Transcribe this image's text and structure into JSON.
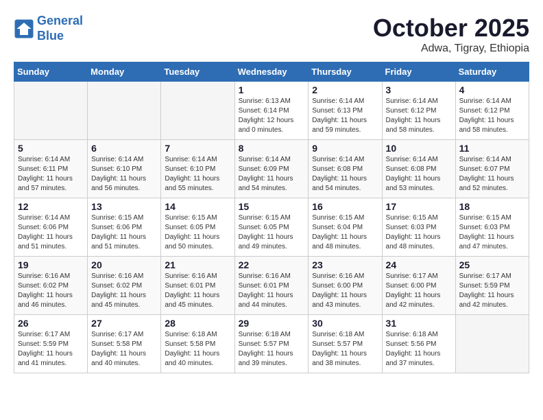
{
  "header": {
    "logo_line1": "General",
    "logo_line2": "Blue",
    "month": "October 2025",
    "location": "Adwa, Tigray, Ethiopia"
  },
  "days_of_week": [
    "Sunday",
    "Monday",
    "Tuesday",
    "Wednesday",
    "Thursday",
    "Friday",
    "Saturday"
  ],
  "weeks": [
    [
      {
        "num": "",
        "info": "",
        "empty": true
      },
      {
        "num": "",
        "info": "",
        "empty": true
      },
      {
        "num": "",
        "info": "",
        "empty": true
      },
      {
        "num": "1",
        "info": "Sunrise: 6:13 AM\nSunset: 6:14 PM\nDaylight: 12 hours\nand 0 minutes."
      },
      {
        "num": "2",
        "info": "Sunrise: 6:14 AM\nSunset: 6:13 PM\nDaylight: 11 hours\nand 59 minutes."
      },
      {
        "num": "3",
        "info": "Sunrise: 6:14 AM\nSunset: 6:12 PM\nDaylight: 11 hours\nand 58 minutes."
      },
      {
        "num": "4",
        "info": "Sunrise: 6:14 AM\nSunset: 6:12 PM\nDaylight: 11 hours\nand 58 minutes."
      }
    ],
    [
      {
        "num": "5",
        "info": "Sunrise: 6:14 AM\nSunset: 6:11 PM\nDaylight: 11 hours\nand 57 minutes."
      },
      {
        "num": "6",
        "info": "Sunrise: 6:14 AM\nSunset: 6:10 PM\nDaylight: 11 hours\nand 56 minutes."
      },
      {
        "num": "7",
        "info": "Sunrise: 6:14 AM\nSunset: 6:10 PM\nDaylight: 11 hours\nand 55 minutes."
      },
      {
        "num": "8",
        "info": "Sunrise: 6:14 AM\nSunset: 6:09 PM\nDaylight: 11 hours\nand 54 minutes."
      },
      {
        "num": "9",
        "info": "Sunrise: 6:14 AM\nSunset: 6:08 PM\nDaylight: 11 hours\nand 54 minutes."
      },
      {
        "num": "10",
        "info": "Sunrise: 6:14 AM\nSunset: 6:08 PM\nDaylight: 11 hours\nand 53 minutes."
      },
      {
        "num": "11",
        "info": "Sunrise: 6:14 AM\nSunset: 6:07 PM\nDaylight: 11 hours\nand 52 minutes."
      }
    ],
    [
      {
        "num": "12",
        "info": "Sunrise: 6:14 AM\nSunset: 6:06 PM\nDaylight: 11 hours\nand 51 minutes."
      },
      {
        "num": "13",
        "info": "Sunrise: 6:15 AM\nSunset: 6:06 PM\nDaylight: 11 hours\nand 51 minutes."
      },
      {
        "num": "14",
        "info": "Sunrise: 6:15 AM\nSunset: 6:05 PM\nDaylight: 11 hours\nand 50 minutes."
      },
      {
        "num": "15",
        "info": "Sunrise: 6:15 AM\nSunset: 6:05 PM\nDaylight: 11 hours\nand 49 minutes."
      },
      {
        "num": "16",
        "info": "Sunrise: 6:15 AM\nSunset: 6:04 PM\nDaylight: 11 hours\nand 48 minutes."
      },
      {
        "num": "17",
        "info": "Sunrise: 6:15 AM\nSunset: 6:03 PM\nDaylight: 11 hours\nand 48 minutes."
      },
      {
        "num": "18",
        "info": "Sunrise: 6:15 AM\nSunset: 6:03 PM\nDaylight: 11 hours\nand 47 minutes."
      }
    ],
    [
      {
        "num": "19",
        "info": "Sunrise: 6:16 AM\nSunset: 6:02 PM\nDaylight: 11 hours\nand 46 minutes."
      },
      {
        "num": "20",
        "info": "Sunrise: 6:16 AM\nSunset: 6:02 PM\nDaylight: 11 hours\nand 45 minutes."
      },
      {
        "num": "21",
        "info": "Sunrise: 6:16 AM\nSunset: 6:01 PM\nDaylight: 11 hours\nand 45 minutes."
      },
      {
        "num": "22",
        "info": "Sunrise: 6:16 AM\nSunset: 6:01 PM\nDaylight: 11 hours\nand 44 minutes."
      },
      {
        "num": "23",
        "info": "Sunrise: 6:16 AM\nSunset: 6:00 PM\nDaylight: 11 hours\nand 43 minutes."
      },
      {
        "num": "24",
        "info": "Sunrise: 6:17 AM\nSunset: 6:00 PM\nDaylight: 11 hours\nand 42 minutes."
      },
      {
        "num": "25",
        "info": "Sunrise: 6:17 AM\nSunset: 5:59 PM\nDaylight: 11 hours\nand 42 minutes."
      }
    ],
    [
      {
        "num": "26",
        "info": "Sunrise: 6:17 AM\nSunset: 5:59 PM\nDaylight: 11 hours\nand 41 minutes."
      },
      {
        "num": "27",
        "info": "Sunrise: 6:17 AM\nSunset: 5:58 PM\nDaylight: 11 hours\nand 40 minutes."
      },
      {
        "num": "28",
        "info": "Sunrise: 6:18 AM\nSunset: 5:58 PM\nDaylight: 11 hours\nand 40 minutes."
      },
      {
        "num": "29",
        "info": "Sunrise: 6:18 AM\nSunset: 5:57 PM\nDaylight: 11 hours\nand 39 minutes."
      },
      {
        "num": "30",
        "info": "Sunrise: 6:18 AM\nSunset: 5:57 PM\nDaylight: 11 hours\nand 38 minutes."
      },
      {
        "num": "31",
        "info": "Sunrise: 6:18 AM\nSunset: 5:56 PM\nDaylight: 11 hours\nand 37 minutes."
      },
      {
        "num": "",
        "info": "",
        "empty": true
      }
    ]
  ]
}
